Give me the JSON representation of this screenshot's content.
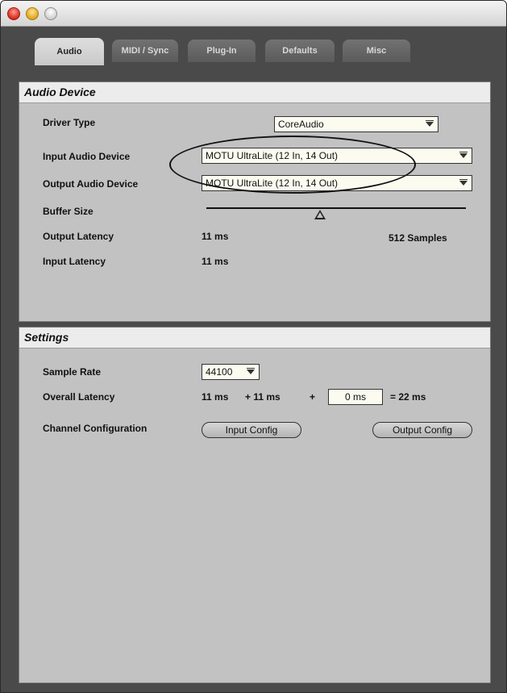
{
  "tabs": [
    {
      "label": "Audio"
    },
    {
      "label": "MIDI / Sync"
    },
    {
      "label": "Plug-In"
    },
    {
      "label": "Defaults"
    },
    {
      "label": "Misc"
    }
  ],
  "audio_device": {
    "title": "Audio Device",
    "driver_type_label": "Driver Type",
    "driver_type_value": "CoreAudio",
    "input_device_label": "Input Audio Device",
    "input_device_value": "MOTU UltraLite (12 In, 14 Out)",
    "output_device_label": "Output Audio Device",
    "output_device_value": "MOTU UltraLite (12 In, 14 Out)",
    "buffer_size_label": "Buffer Size",
    "output_latency_label": "Output Latency",
    "output_latency_value": "11 ms",
    "buffer_samples": "512 Samples",
    "input_latency_label": "Input Latency",
    "input_latency_value": "11 ms"
  },
  "settings": {
    "title": "Settings",
    "sample_rate_label": "Sample Rate",
    "sample_rate_value": "44100",
    "overall_latency_label": "Overall Latency",
    "latency_a": "11 ms",
    "latency_b": "+ 11 ms",
    "plus": "+",
    "extra_latency_value": "0 ms",
    "latency_total": "= 22 ms",
    "channel_config_label": "Channel Configuration",
    "input_config_label": "Input Config",
    "output_config_label": "Output Config"
  }
}
